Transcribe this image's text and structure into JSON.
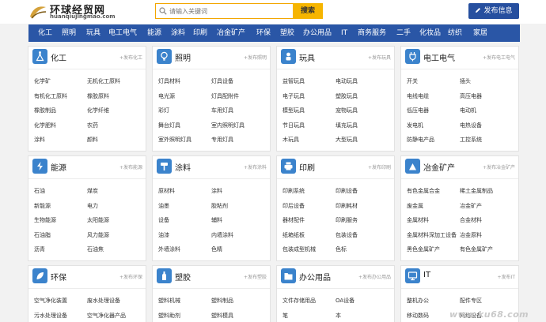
{
  "header": {
    "logo_name": "环球经贸网",
    "logo_domain": "huanqiujingmao.com",
    "search_placeholder": "请输入关键词",
    "search_button": "搜索",
    "post_button": "发布信息"
  },
  "nav": [
    "化工",
    "照明",
    "玩具",
    "电工电气",
    "能源",
    "涂料",
    "印刷",
    "冶金矿产",
    "环保",
    "塑胶",
    "办公用品",
    "IT",
    "商务服务",
    "二手",
    "化妆品",
    "纺织",
    "家居"
  ],
  "cards": [
    {
      "title": "化工",
      "post": "+发布化工",
      "links": [
        "化学矿",
        "无机化工原料",
        "有机化工原料",
        "橡胶原料",
        "橡胶制品",
        "化学纤维",
        "化学肥料",
        "农药",
        "涂料",
        "颜料"
      ]
    },
    {
      "title": "照明",
      "post": "+发布照明",
      "links": [
        "灯具材料",
        "灯具设备",
        "电光源",
        "灯具配附件",
        "彩灯",
        "车用灯具",
        "舞台灯具",
        "室内照明灯具",
        "室外照明灯具",
        "专用灯具"
      ]
    },
    {
      "title": "玩具",
      "post": "+发布玩具",
      "links": [
        "益智玩具",
        "电动玩具",
        "电子玩具",
        "塑胶玩具",
        "模型玩具",
        "宠物玩具",
        "节日玩具",
        "填充玩具",
        "木玩具",
        "大型玩具"
      ]
    },
    {
      "title": "电工电气",
      "post": "+发布电工电气",
      "links": [
        "开关",
        "插头",
        "电线电缆",
        "高压电器",
        "低压电器",
        "电动机",
        "发电机",
        "电热设备",
        "防静电产品",
        "工控系统"
      ]
    },
    {
      "title": "能源",
      "post": "+发布能源",
      "links": [
        "石油",
        "煤炭",
        "新能源",
        "电力",
        "生物能源",
        "太阳能源",
        "石油脂",
        "风力能源",
        "沥青",
        "石油焦"
      ]
    },
    {
      "title": "涂料",
      "post": "+发布涂料",
      "links": [
        "原材料",
        "涂料",
        "油墨",
        "胶粘剂",
        "设备",
        "辅料",
        "油漆",
        "内墙涂料",
        "外墙涂料",
        "色精"
      ]
    },
    {
      "title": "印刷",
      "post": "+发布印刷",
      "links": [
        "印刷系统",
        "印刷设备",
        "印后设备",
        "印刷耗材",
        "器材配件",
        "印刷服务",
        "纸箱纸板",
        "包装设备",
        "包装成型机械",
        "色标"
      ]
    },
    {
      "title": "冶金矿产",
      "post": "+发布冶金矿产",
      "links": [
        "有色金属合金",
        "稀土金属制品",
        "废金属",
        "冶金矿产",
        "金属材料",
        "合金材料",
        "金属材料深加工设备",
        "冶金原料",
        "黑色金属矿产",
        "有色金属矿产"
      ]
    },
    {
      "title": "环保",
      "post": "+发布环保",
      "links": [
        "空气净化装置",
        "废水处理设备",
        "污水处理设备",
        "空气净化器产品"
      ]
    },
    {
      "title": "塑胶",
      "post": "+发布塑胶",
      "links": [
        "塑料机械",
        "塑料制品",
        "塑料助剂",
        "塑料模具"
      ]
    },
    {
      "title": "办公用品",
      "post": "+发布办公用品",
      "links": [
        "文件存储用品",
        "OA设备",
        "笔",
        "本"
      ]
    },
    {
      "title": "IT",
      "post": "+发布IT",
      "links": [
        "整机办公",
        "配件专区",
        "移动数码",
        "网络设备"
      ]
    }
  ],
  "watermark": "www.ku68.com",
  "colors": {
    "nav_bg": "#2a56a6",
    "search_border": "#f3a600",
    "search_button": "#f6b500",
    "post_button": "#264f9f",
    "card_icon": "#3b83cc"
  },
  "icons": {
    "化工": "flask-icon",
    "照明": "bulb-icon",
    "玩具": "toy-icon",
    "电工电气": "plug-icon",
    "能源": "energy-icon",
    "涂料": "paint-icon",
    "印刷": "printer-icon",
    "冶金矿产": "mine-icon",
    "环保": "leaf-icon",
    "塑胶": "bottle-icon",
    "办公用品": "folder-icon",
    "IT": "monitor-icon"
  }
}
